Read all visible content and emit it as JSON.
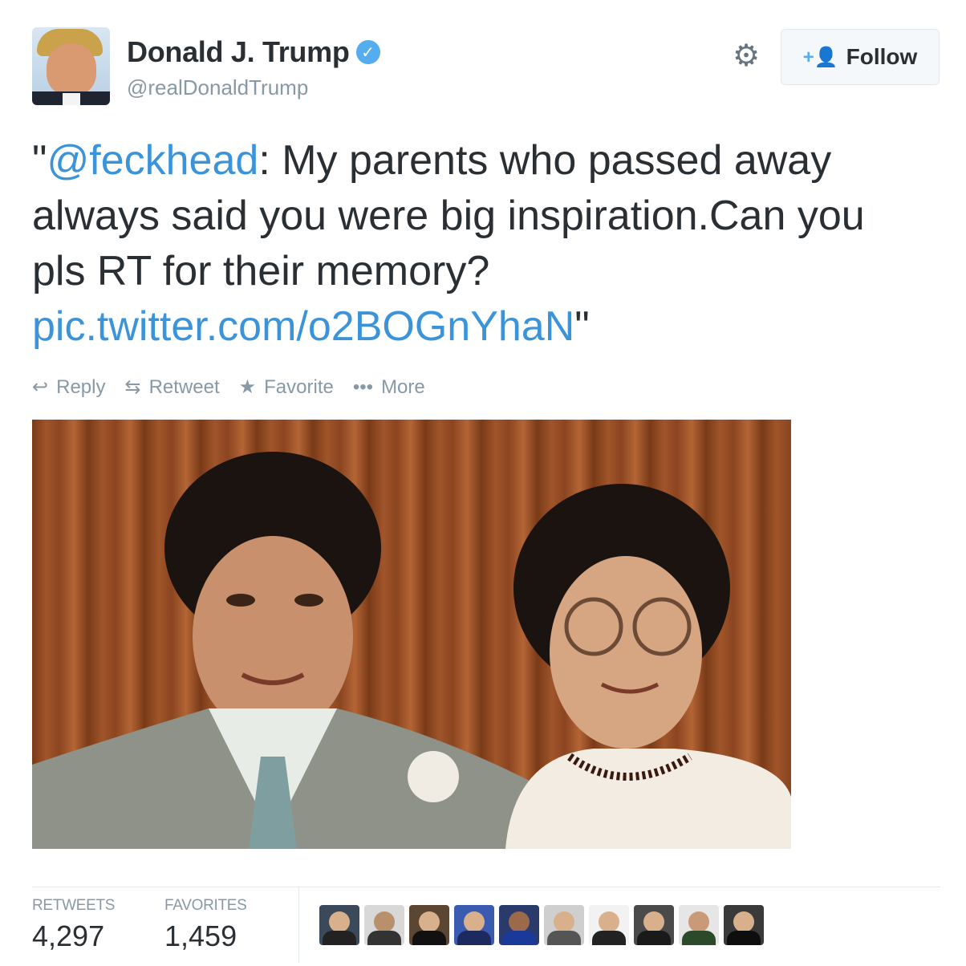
{
  "user": {
    "name": "Donald J. Trump",
    "handle": "@realDonaldTrump",
    "verified_glyph": "✓"
  },
  "header": {
    "settings_icon": "gear-icon",
    "follow_label": "Follow",
    "follow_icon": "add-user-icon"
  },
  "tweet": {
    "quote_open": "\"",
    "mention": "@feckhead",
    "text": ":  My parents who passed away always said you were big inspiration.Can you pls RT for their memory? ",
    "link": "pic.twitter.com/o2BOGnYhaN",
    "quote_close": "\""
  },
  "actions": [
    {
      "label": "Reply",
      "icon": "reply-icon"
    },
    {
      "label": "Retweet",
      "icon": "retweet-icon"
    },
    {
      "label": "Favorite",
      "icon": "star-icon"
    },
    {
      "label": "More",
      "icon": "more-icon"
    }
  ],
  "stats": {
    "retweets_label": "RETWEETS",
    "retweets_value": "4,297",
    "favorites_label": "FAVORITES",
    "favorites_value": "1,459"
  },
  "colors": {
    "accent": "#55acee",
    "link": "#3b94d9",
    "muted": "#8899a6",
    "text": "#292f33"
  }
}
